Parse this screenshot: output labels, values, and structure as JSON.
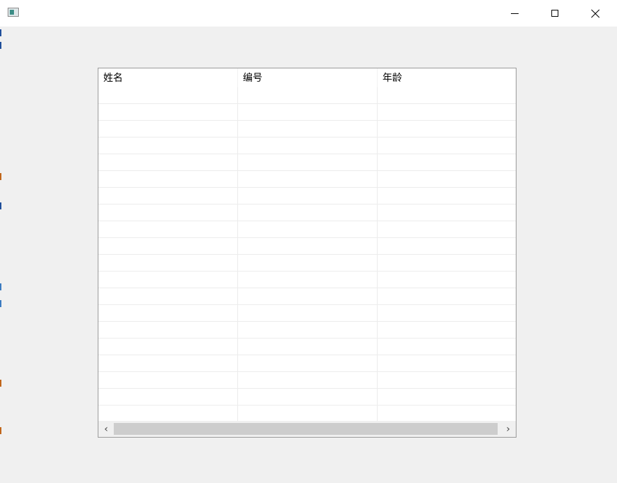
{
  "window": {
    "title": "",
    "controls": {
      "minimize_icon": "minimize-icon",
      "maximize_icon": "maximize-icon",
      "close_icon": "close-icon"
    }
  },
  "table": {
    "columns": [
      {
        "label": "姓名"
      },
      {
        "label": "编号"
      },
      {
        "label": "年龄"
      }
    ],
    "rows": [
      [
        "",
        "",
        ""
      ],
      [
        "",
        "",
        ""
      ],
      [
        "",
        "",
        ""
      ],
      [
        "",
        "",
        ""
      ],
      [
        "",
        "",
        ""
      ],
      [
        "",
        "",
        ""
      ],
      [
        "",
        "",
        ""
      ],
      [
        "",
        "",
        ""
      ],
      [
        "",
        "",
        ""
      ],
      [
        "",
        "",
        ""
      ],
      [
        "",
        "",
        ""
      ],
      [
        "",
        "",
        ""
      ],
      [
        "",
        "",
        ""
      ],
      [
        "",
        "",
        ""
      ],
      [
        "",
        "",
        ""
      ],
      [
        "",
        "",
        ""
      ],
      [
        "",
        "",
        ""
      ],
      [
        "",
        "",
        ""
      ],
      [
        "",
        "",
        ""
      ],
      [
        "",
        "",
        ""
      ]
    ]
  },
  "scrollbar": {
    "left_arrow": "‹",
    "right_arrow": "›"
  },
  "colors": {
    "window_bg": "#f0f0f0",
    "titlebar_bg": "#ffffff",
    "grid_line": "#ececec",
    "scroll_thumb": "#cdcdcd"
  }
}
